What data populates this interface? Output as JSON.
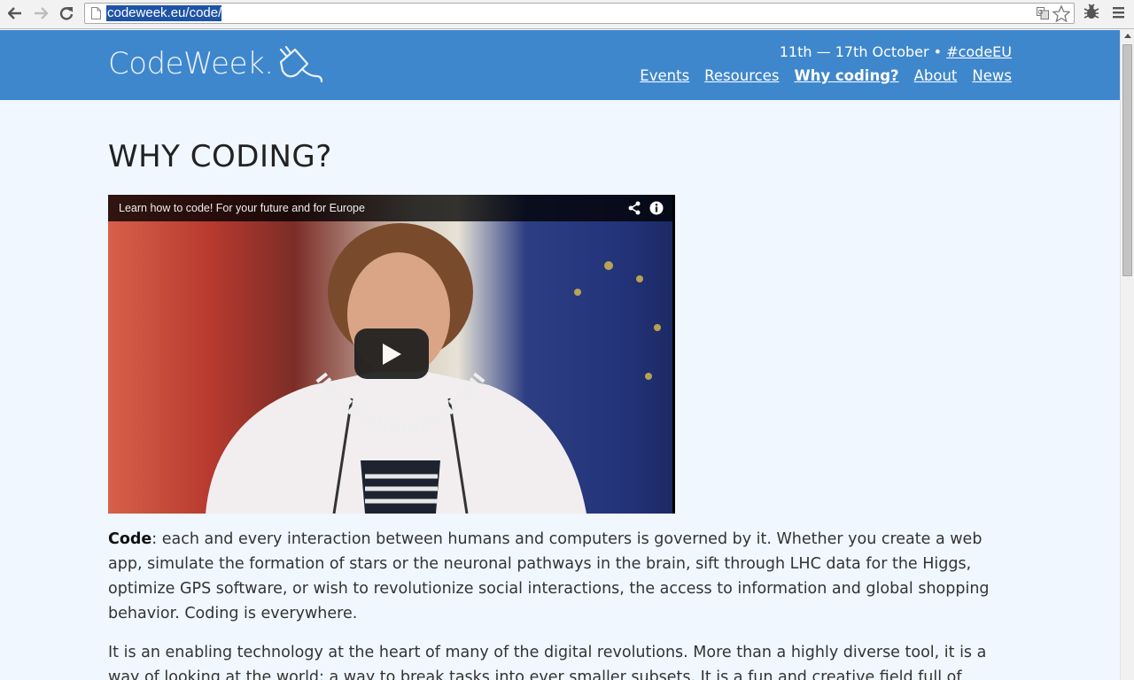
{
  "browser": {
    "url": "codeweek.eu/code/"
  },
  "header": {
    "logo_text": "CodeWeek.",
    "dates": "11th — 17th October •",
    "hashtag": "#codeEU",
    "nav": [
      {
        "label": "Events",
        "active": false
      },
      {
        "label": "Resources",
        "active": false
      },
      {
        "label": "Why coding?",
        "active": true
      },
      {
        "label": "About",
        "active": false
      },
      {
        "label": "News",
        "active": false
      }
    ]
  },
  "main": {
    "title": "WHY CODING?",
    "video": {
      "title": "Learn how to code! For your future and for Europe"
    },
    "paragraph1": {
      "bold": "Code",
      "text": ": each and every interaction between humans and computers is governed by it. Whether you create a web app, simulate the formation of stars or the neuronal pathways in the brain, sift through LHC data for the Higgs, optimize GPS software, or wish to revolutionize social interactions, the access to information and global shopping behavior. Coding is everywhere."
    },
    "paragraph2": "It is an enabling technology at the heart of many of the digital revolutions. More than a highly diverse tool, it is a way of looking at the world: a way to break tasks into ever smaller subsets. It is a fun and creative field full of"
  },
  "colors": {
    "header_bg": "#3f87cc",
    "page_bg": "#f0f7fe",
    "url_highlight": "#1e53a6"
  }
}
